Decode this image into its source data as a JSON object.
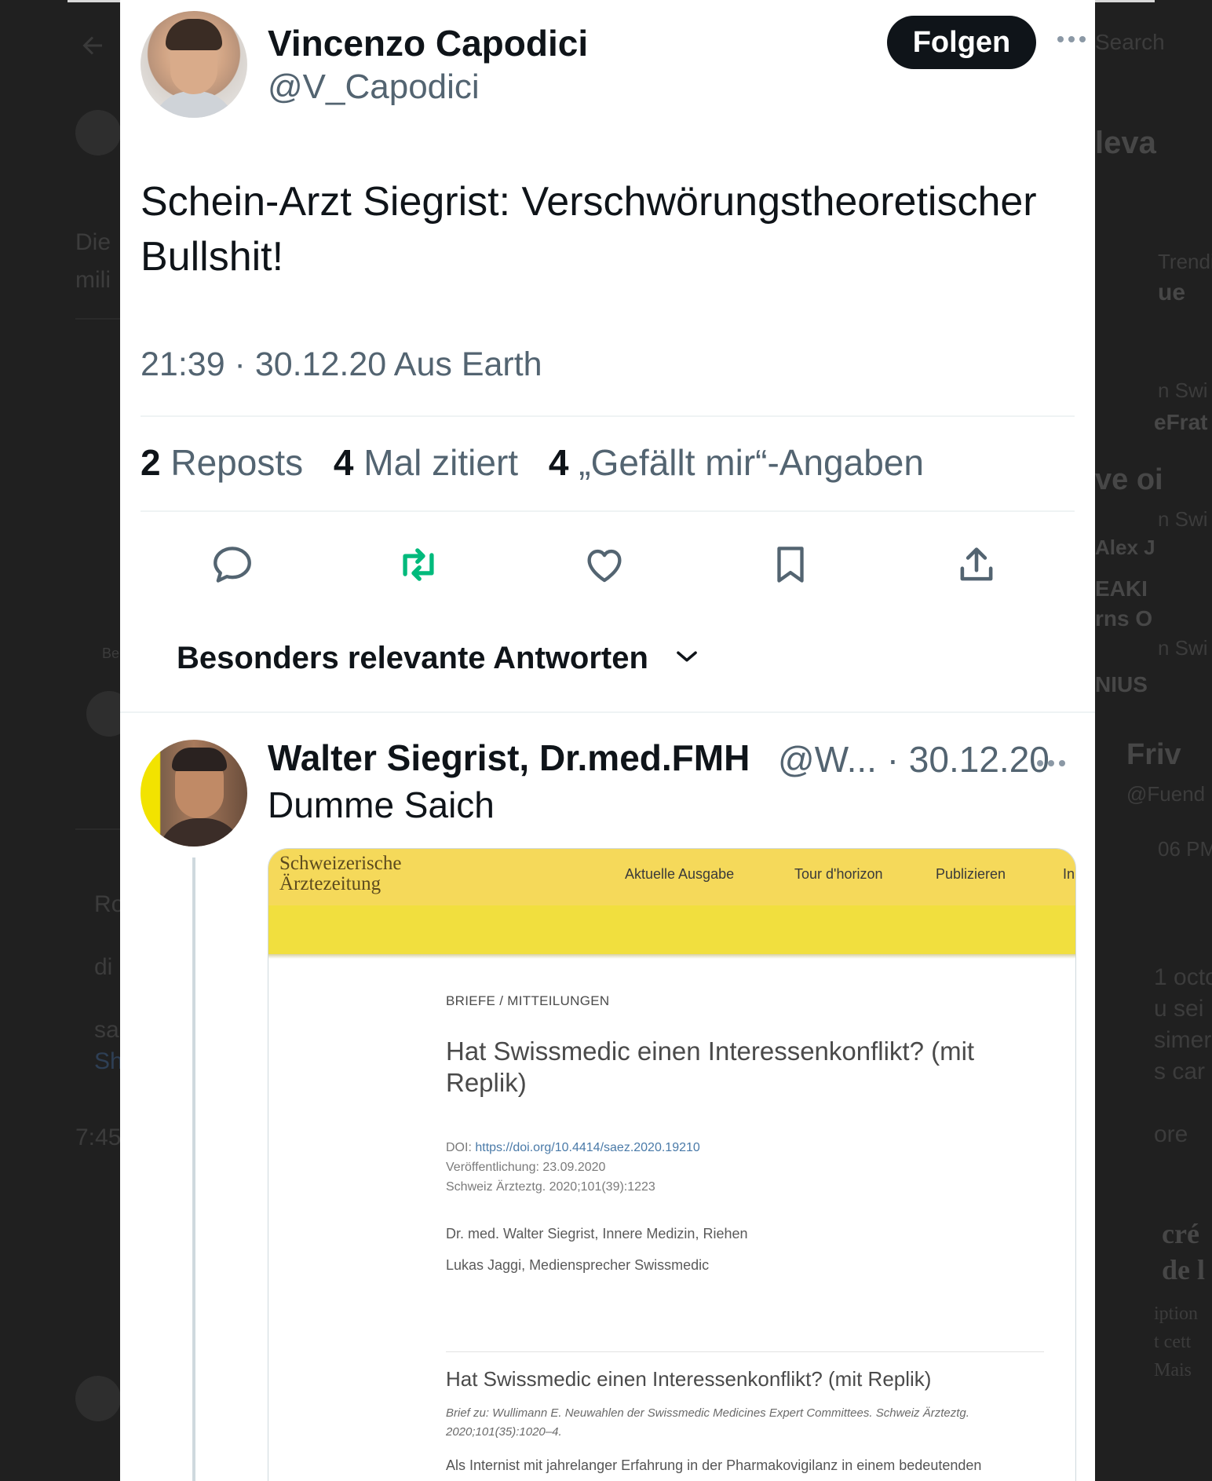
{
  "tweet": {
    "author_name": "Vincenzo Capodici",
    "author_handle": "@V_Capodici",
    "follow_label": "Folgen",
    "text": "Schein-Arzt Siegrist: Verschwörungstheoretischer Bullshit!",
    "meta": "21:39 · 30.12.20 Aus Earth",
    "stats": {
      "reposts_count": "2",
      "reposts_label": "Reposts",
      "quotes_count": "4",
      "quotes_label": "Mal zitiert",
      "likes_count": "4",
      "likes_label": "„Gefällt mir“-Angaben"
    },
    "actions": [
      "reply-icon",
      "repost-icon",
      "like-icon",
      "bookmark-icon",
      "share-icon"
    ],
    "repost_color": "#00ba7c"
  },
  "replies_sort": {
    "label": "Besonders relevante Antworten"
  },
  "reply": {
    "author_name": "Walter Siegrist, Dr.med.FMH",
    "author_handle_date": "@W... · 30.12.20",
    "text": "Dumme Saich",
    "embed": {
      "logo_line1": "Schweizerische",
      "logo_line2": "Ärztezeitung",
      "nav": [
        "Aktuelle Ausgabe",
        "Tour d'horizon",
        "Publizieren",
        "In"
      ],
      "category": "BRIEFE / MITTEILUNGEN",
      "title": "Hat Swissmedic einen Interessenkonflikt? (mit Replik)",
      "doi_label": "DOI:",
      "doi_link": "https://doi.org/10.4414/saez.2020.19210",
      "published": "Veröffentlichung: 23.09.2020",
      "citation": "Schweiz Ärzteztg. 2020;101(39):1223",
      "author1": "Dr. med. Walter Siegrist, Innere Medizin, Riehen",
      "author2": "Lukas Jaggi, Mediensprecher Swissmedic",
      "subtitle": "Hat Swissmedic einen Interessenkonflikt? (mit Replik)",
      "reference": "Brief zu: Wullimann E. Neuwahlen der Swissmedic Medicines Expert Committees. Schweiz Ärzteztg. 2020;101(35):1020–4.",
      "body": "Als Internist mit jahrelanger Erfahrung in der Pharmakovigilanz in einem bedeutenden pharmazeutischen Unternehmen bin ich bisher immer davon ausgegangen, dass die"
    }
  },
  "background": {
    "search_placeholder": "Search",
    "left_fragments": [
      "Die",
      "mili",
      "Ro",
      "di",
      "sa",
      "Sh",
      "7:45",
      "Be"
    ],
    "right_fragments": [
      "leva",
      "Trendi",
      "ue",
      "n Swi",
      "eFrat",
      "ve oi",
      "n Swi",
      "Alex J",
      "EAKI",
      "rns O",
      "n Swi",
      "NIUS",
      "Friv",
      "@Fuend",
      "06 PM",
      "1 octo",
      "u sei",
      "simer",
      "s car",
      "ore",
      "cré",
      "de l",
      "iption",
      "t cett",
      "Mais"
    ]
  }
}
